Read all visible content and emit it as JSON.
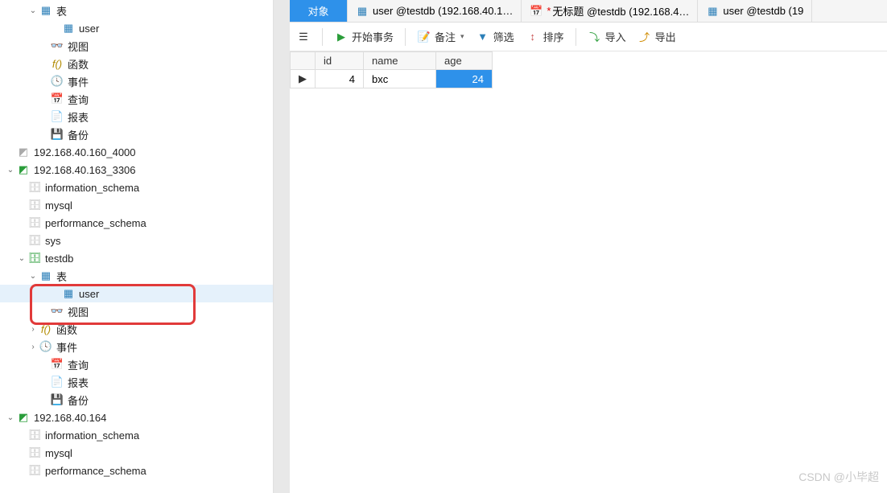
{
  "tree": {
    "conn1_items": {
      "tables": "表",
      "user_table": "user",
      "views": "视图",
      "functions": "函数",
      "events": "事件",
      "queries": "查询",
      "reports": "报表",
      "backups": "备份"
    },
    "conn2": "192.168.40.160_4000",
    "conn3": "192.168.40.163_3306",
    "conn3_dbs": {
      "info_schema": "information_schema",
      "mysql": "mysql",
      "perf_schema": "performance_schema",
      "sys": "sys",
      "testdb": "testdb"
    },
    "testdb_items": {
      "tables": "表",
      "user_table": "user",
      "views": "视图",
      "functions": "函数",
      "events": "事件",
      "queries": "查询",
      "reports": "报表",
      "backups": "备份"
    },
    "conn4": "192.168.40.164",
    "conn4_dbs": {
      "info_schema": "information_schema",
      "mysql": "mysql",
      "perf_schema": "performance_schema"
    }
  },
  "tabs": {
    "objects": "对象",
    "user1": "user @testdb (192.168.40.1…",
    "untitled": "无标题 @testdb (192.168.4…",
    "untitled_mod": "*",
    "user2": "user @testdb (19"
  },
  "toolbar": {
    "begin_txn": "开始事务",
    "notes": "备注",
    "filter": "筛选",
    "sort": "排序",
    "import": "导入",
    "export": "导出"
  },
  "grid": {
    "headers": {
      "id": "id",
      "name": "name",
      "age": "age"
    },
    "rows": [
      {
        "id": "4",
        "name": "bxc",
        "age": "24"
      }
    ]
  },
  "watermark": "CSDN @小毕超"
}
